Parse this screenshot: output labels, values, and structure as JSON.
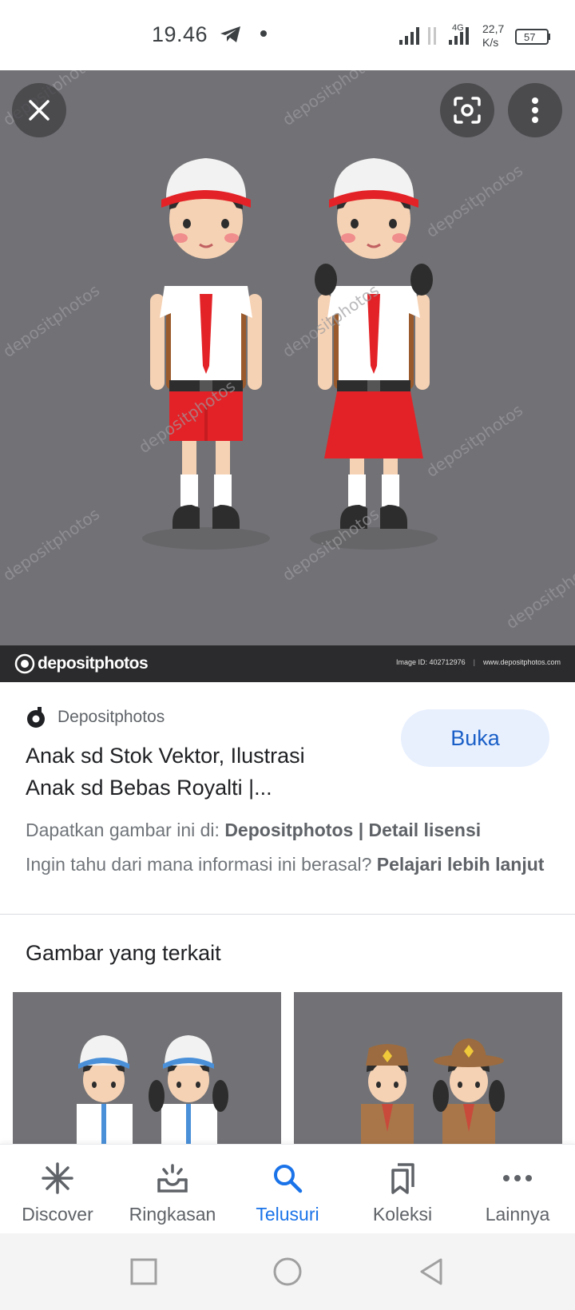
{
  "status_bar": {
    "time": "19.46",
    "network": "4G",
    "speed": "22,7",
    "speed_unit": "K/s",
    "battery": "57"
  },
  "viewer": {
    "watermark": "depositphotos",
    "logo_text": "depositphotos",
    "image_id": "Image ID: 402712976",
    "site": "www.depositphotos.com",
    "close_icon": "close-icon",
    "lens_icon": "lens-icon",
    "more_icon": "more-vertical-icon"
  },
  "result": {
    "source": "Depositphotos",
    "title": "Anak sd Stok Vektor, Ilustrasi Anak sd Bebas Royalti |...",
    "open_label": "Buka",
    "license_prefix": "Dapatkan gambar ini di:",
    "license_source": "Depositphotos",
    "license_sep": "|",
    "license_detail": "Detail lisensi",
    "learn_prefix": "Ingin tahu dari mana informasi ini berasal?",
    "learn_link": "Pelajari lebih lanjut"
  },
  "related": {
    "heading": "Gambar yang terkait"
  },
  "bottom_nav": {
    "items": [
      {
        "label": "Discover",
        "icon": "asterisk-icon"
      },
      {
        "label": "Ringkasan",
        "icon": "tray-icon"
      },
      {
        "label": "Telusuri",
        "icon": "search-icon",
        "active": true
      },
      {
        "label": "Koleksi",
        "icon": "bookmarks-icon"
      },
      {
        "label": "Lainnya",
        "icon": "more-horizontal-icon"
      }
    ]
  },
  "colors": {
    "accent": "#1a73e8",
    "viewer_bg": "#727276",
    "tie_red": "#e32227"
  }
}
